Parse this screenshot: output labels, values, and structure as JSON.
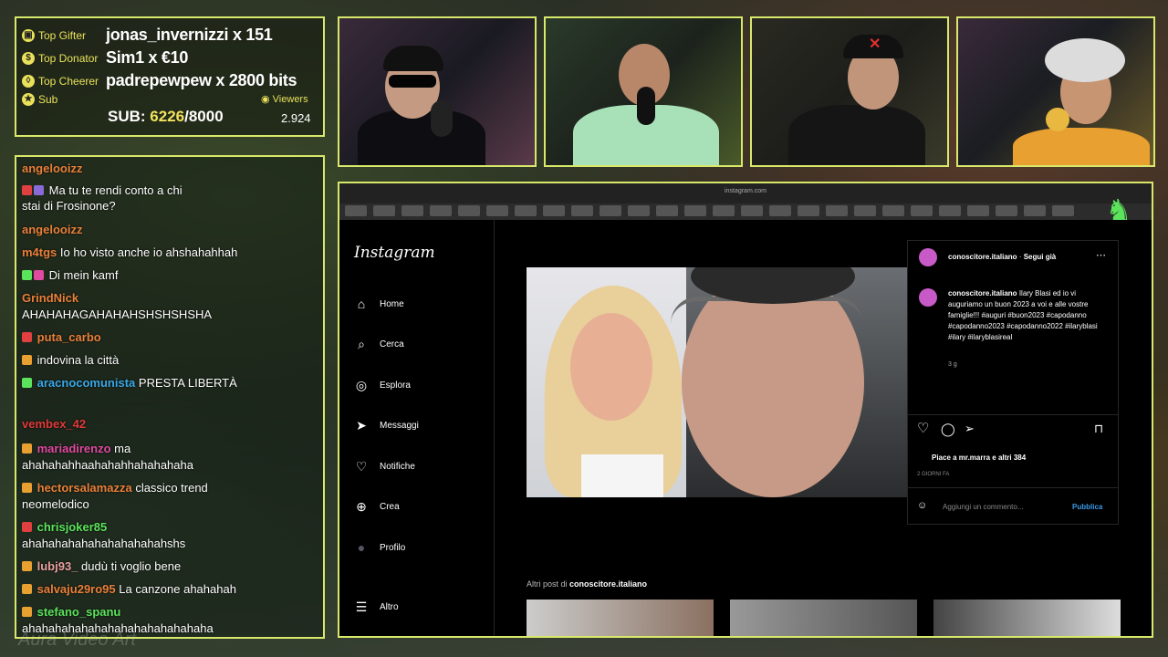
{
  "stats": {
    "top_gifter_label": "Top Gifter",
    "top_gifter": "jonas_invernizzi x 151",
    "top_donator_label": "Top Donator",
    "top_donator": "Sim1 x €10",
    "top_cheerer_label": "Top Cheerer",
    "top_cheerer": "padrepewpew x 2800 bits",
    "sub_label": "Sub",
    "sub_prefix": "SUB: ",
    "sub_current": "6226",
    "sub_goal": "/8000",
    "viewers_label": "Viewers",
    "viewers_value": "2.924"
  },
  "chat": {
    "messages": [
      {
        "user": "angelooizz",
        "text": "",
        "color": "#e8803a"
      },
      {
        "user": "",
        "text": "Ma tu te rendi conto a chi",
        "color": "#8a6ad8"
      },
      {
        "user": "",
        "text": "stai di Frosinone?",
        "color": "#ffffff"
      },
      {
        "user": "angelooizz",
        "text": "",
        "color": "#e8803a"
      },
      {
        "user": "m4tgs",
        "text": "Io ho visto anche io ahshahahhah",
        "color": "#e8803a"
      },
      {
        "user": "",
        "text": "Di mein kamf",
        "color": "#e04aa0"
      },
      {
        "user": "GrindNick",
        "text": "",
        "color": "#e8803a"
      },
      {
        "user": "",
        "text": "AHAHAHAGAHAHAHSHSHSHSHA",
        "color": "#ffffff"
      },
      {
        "user": "puta_carbo",
        "text": "",
        "color": "#e8803a"
      },
      {
        "user": "",
        "text": "indovina la città",
        "color": "#8a6ad8"
      },
      {
        "user": "aracnocomunista",
        "text": "PRESTA LIBERTÀ",
        "color": "#3aa8e8"
      },
      {
        "user": "vembex_42",
        "text": "",
        "color": "#e03a3a"
      },
      {
        "user": "mariadirenzo",
        "text": "ma",
        "color": "#e04aa0"
      },
      {
        "user": "",
        "text": "ahahahahhaahahahhahahahaha",
        "color": "#ffffff"
      },
      {
        "user": "hectorsalamazza",
        "text": "classico trend",
        "color": "#e8803a"
      },
      {
        "user": "",
        "text": "neomelodico",
        "color": "#ffffff"
      },
      {
        "user": "chrisjoker85",
        "text": "",
        "color": "#5ce35c"
      },
      {
        "user": "",
        "text": "ahahahahahahahahahahahshs",
        "color": "#ffffff"
      },
      {
        "user": "lubj93_",
        "text": "dudù ti voglio bene",
        "color": "#e8a0a0"
      },
      {
        "user": "salvaju29ro95",
        "text": "La canzone ahahahah",
        "color": "#e8803a"
      },
      {
        "user": "stefano_spanu",
        "text": "",
        "color": "#5ce35c"
      },
      {
        "user": "",
        "text": "ahahahahahahahahahahahahahaha",
        "color": "#ffffff"
      }
    ]
  },
  "browser": {
    "url": "instagram.com"
  },
  "instagram": {
    "logo": "Instagram",
    "nav": [
      {
        "label": "Home",
        "icon": "home-icon",
        "glyph": "⌂"
      },
      {
        "label": "Cerca",
        "icon": "search-icon",
        "glyph": "⌕"
      },
      {
        "label": "Esplora",
        "icon": "compass-icon",
        "glyph": "◎"
      },
      {
        "label": "Messaggi",
        "icon": "messenger-icon",
        "glyph": "➤"
      },
      {
        "label": "Notifiche",
        "icon": "heart-icon",
        "glyph": "♡"
      },
      {
        "label": "Crea",
        "icon": "plus-icon",
        "glyph": "⊕"
      },
      {
        "label": "Profilo",
        "icon": "avatar-icon",
        "glyph": "●"
      },
      {
        "label": "Altro",
        "icon": "menu-icon",
        "glyph": "☰"
      }
    ],
    "post": {
      "author": "conoscitore.italiano",
      "follow": "Segui già",
      "caption_user": "conoscitore.italiano",
      "caption": "Ilary Blasi ed io vi auguriamo un buon 2023 a voi e alle vostre famiglie!!! #auguri #buon2023 #capodanno #capodanno2023 #capodanno2022 #ilaryblasi #ilary #ilaryblasireal",
      "age": "3 g",
      "likes": "Piace a mr.marra e altri 384",
      "date": "2 GIORNI FA",
      "comment_placeholder": "Aggiungi un commento...",
      "publish": "Pubblica",
      "more_posts_prefix": "Altri post di ",
      "more_posts_user": "conoscitore.italiano"
    }
  },
  "watermark": "Aura Video Art"
}
